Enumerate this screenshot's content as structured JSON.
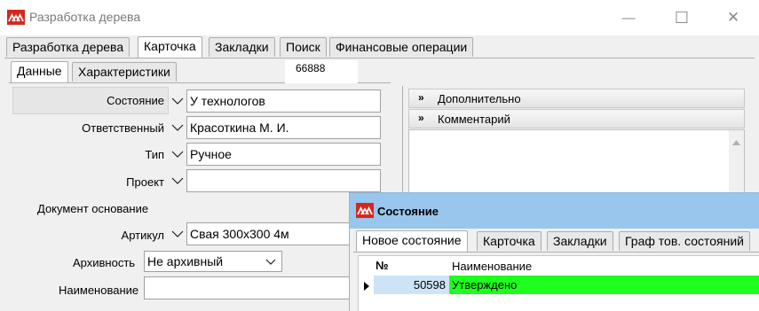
{
  "window": {
    "title": "Разработка дерева",
    "minimize": "—",
    "maximize": "☐",
    "close": "✕"
  },
  "main_tabs": [
    "Разработка дерева",
    "Карточка",
    "Закладки",
    "Поиск",
    "Финансовые операции"
  ],
  "sub_tabs": [
    "Данные",
    "Характеристики"
  ],
  "record_number": "66888",
  "form": {
    "status_label": "Состояние",
    "status_value": "У технологов",
    "responsible_label": "Ответственный",
    "responsible_value": "Красоткина М. И.",
    "type_label": "Тип",
    "type_value": "Ручное",
    "project_label": "Проект",
    "project_value": "",
    "base_doc_label": "Документ основание",
    "article_label": "Артикул",
    "article_value": "Свая 300х300 4м",
    "archive_label": "Архивность",
    "archive_value": "Не архивный",
    "name_label": "Наименование",
    "name_value": ""
  },
  "right_panel": {
    "additional": "Дополнительно",
    "comment": "Комментарий"
  },
  "dialog": {
    "title": "Состояние",
    "tabs": [
      "Новое состояние",
      "Карточка",
      "Закладки",
      "Граф тов. состояний"
    ],
    "columns": [
      "№",
      "Наименование"
    ],
    "rows": [
      {
        "no": "50598",
        "name": "Утверждено"
      }
    ],
    "row_color": "#1eff1e",
    "selected_cell_color": "#cde4f6"
  },
  "colors": {
    "logo": "#d6271f",
    "dialog_title": "#99c6ec"
  }
}
